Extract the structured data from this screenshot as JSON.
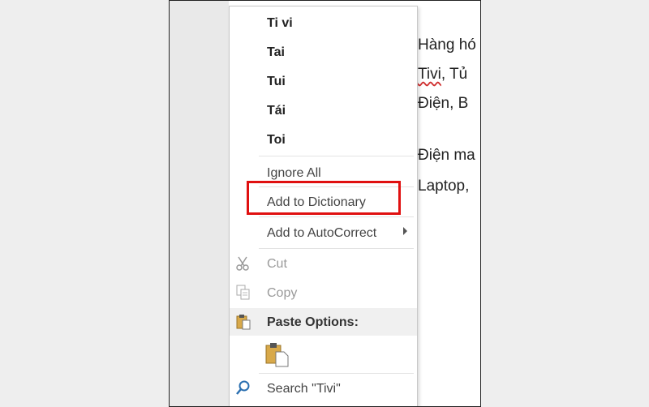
{
  "document": {
    "lines": [
      {
        "text": "Hàng hó",
        "spell": false
      },
      {
        "text_pre": "",
        "text_err": "Tivi",
        "text_post": ", Tủ"
      },
      {
        "text": "Điện, B",
        "spell": false
      },
      {
        "text": "Điện ma",
        "spell": false
      },
      {
        "text": "Laptop,",
        "spell": false
      }
    ]
  },
  "context_menu": {
    "suggestions": [
      "Ti vi",
      "Tai",
      "Tui",
      "Tái",
      "Toi"
    ],
    "ignore_all": "Ignore All",
    "add_to_dictionary": "Add to Dictionary",
    "add_to_autocorrect": "Add to AutoCorrect",
    "cut": "Cut",
    "copy": "Copy",
    "paste_options": "Paste Options:",
    "search": "Search \"Tivi\""
  },
  "colors": {
    "highlight_border": "#e01010",
    "spell_error_underline": "#d03030"
  }
}
